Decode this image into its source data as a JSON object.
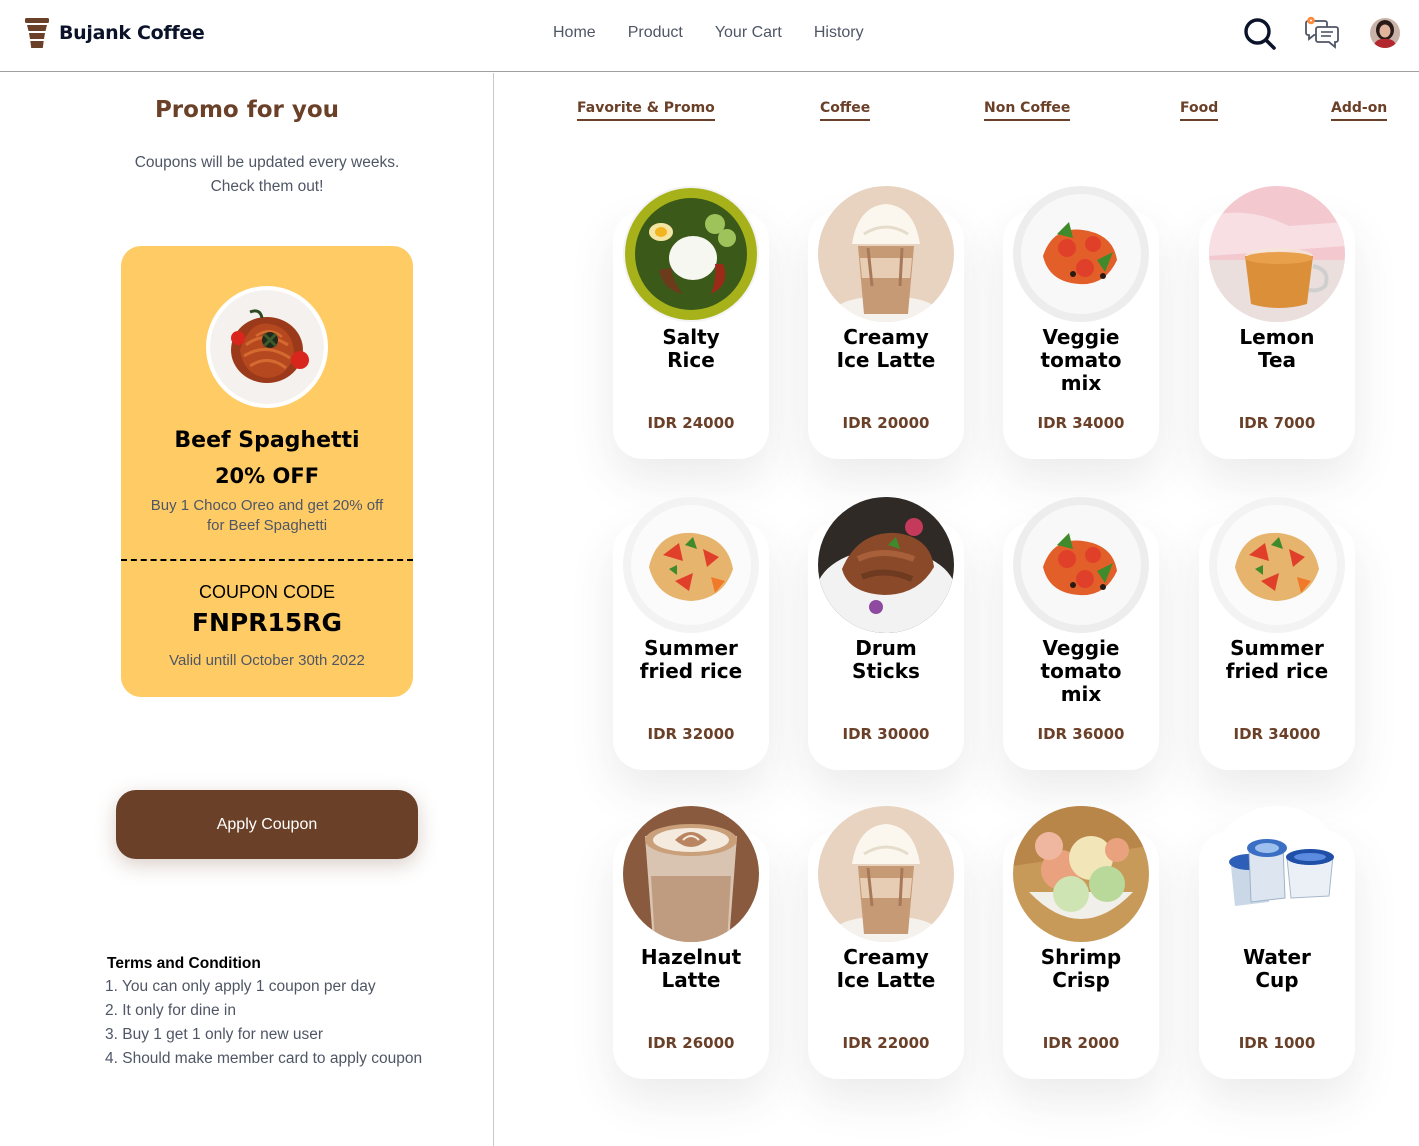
{
  "app": {
    "brand": "Bujank Coffee"
  },
  "nav": {
    "home": "Home",
    "product": "Product",
    "cart": "Your Cart",
    "history": "History"
  },
  "promo": {
    "title": "Promo for you",
    "subtitle_line1": "Coupons will be updated every weeks.",
    "subtitle_line2": "Check them out!",
    "coupon": {
      "item_name": "Beef Spaghetti",
      "discount": "20% OFF",
      "desc_line1": "Buy 1 Choco Oreo and get 20% off",
      "desc_line2": "for Beef Spaghetti",
      "code_label": "COUPON CODE",
      "code": "FNPR15RG",
      "valid": "Valid untill October 30th 2022"
    },
    "apply_label": "Apply Coupon",
    "terms_title": "Terms and Condition",
    "terms": [
      "1. You can only apply 1 coupon per day",
      "2. It only for dine in",
      "3. Buy 1 get 1 only for new user",
      "4. Should make member card to apply coupon"
    ]
  },
  "categories": [
    "Favorite & Promo",
    "Coffee",
    "Non Coffee",
    "Food",
    "Add-on"
  ],
  "products": [
    {
      "name1": "Salty",
      "name2": "Rice",
      "name3": "",
      "price": "IDR 24000",
      "image": "nasi-lemak-plate"
    },
    {
      "name1": "Creamy",
      "name2": "Ice Latte",
      "name3": "",
      "price": "IDR 20000",
      "image": "iced-latte-cream"
    },
    {
      "name1": "Veggie",
      "name2": "tomato",
      "name3": "mix",
      "price": "IDR 34000",
      "image": "tomato-mix-plate"
    },
    {
      "name1": "Lemon",
      "name2": "Tea",
      "name3": "",
      "price": "IDR 7000",
      "image": "lemon-tea-cup"
    },
    {
      "name1": "Summer",
      "name2": "fried rice",
      "name3": "",
      "price": "IDR 32000",
      "image": "fried-rice-plate"
    },
    {
      "name1": "Drum",
      "name2": "Sticks",
      "name3": "",
      "price": "IDR 30000",
      "image": "drumsticks-plate"
    },
    {
      "name1": "Veggie",
      "name2": "tomato",
      "name3": "mix",
      "price": "IDR 36000",
      "image": "tomato-mix-plate"
    },
    {
      "name1": "Summer",
      "name2": "fried rice",
      "name3": "",
      "price": "IDR 34000",
      "image": "fried-rice-plate"
    },
    {
      "name1": "Hazelnut",
      "name2": "Latte",
      "name3": "",
      "price": "IDR 26000",
      "image": "latte-art-cup"
    },
    {
      "name1": "Creamy",
      "name2": "Ice Latte",
      "name3": "",
      "price": "IDR 22000",
      "image": "iced-latte-cream"
    },
    {
      "name1": "Shrimp",
      "name2": "Crisp",
      "name3": "",
      "price": "IDR 2000",
      "image": "shrimp-crackers-bowl"
    },
    {
      "name1": "Water",
      "name2": "Cup",
      "name3": "",
      "price": "IDR 1000",
      "image": "water-cups"
    }
  ],
  "colors": {
    "brown": "#6a4029",
    "coupon_yellow": "#ffcb65",
    "text_gray": "#4f5665",
    "notif": "#ff8a3d"
  }
}
